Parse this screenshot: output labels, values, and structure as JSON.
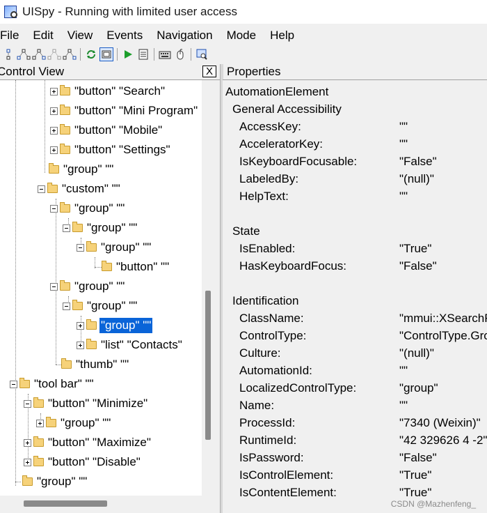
{
  "window": {
    "title": "UISpy - Running with limited user access"
  },
  "menu": [
    "File",
    "Edit",
    "View",
    "Events",
    "Navigation",
    "Mode",
    "Help"
  ],
  "toolbar": [
    "show-parent-icon",
    "show-first-child-icon",
    "show-next-sibling-icon",
    "show-prev-sibling-icon",
    "show-last-child-icon",
    "refresh-icon",
    "focus-tracking-icon",
    "run-icon",
    "properties-icon",
    "keyboard-icon",
    "mouse-icon",
    "screenshot-icon"
  ],
  "left_pane": {
    "title": "Control View",
    "close": "X"
  },
  "tree": [
    {
      "label": "\"button\" \"Search\""
    },
    {
      "label": "\"button\" \"Mini Program\""
    },
    {
      "label": "\"button\" \"Mobile\""
    },
    {
      "label": "\"button\" \"Settings\""
    },
    {
      "label": "\"group\" \"\""
    },
    {
      "label": "\"custom\" \"\""
    },
    {
      "label": "\"group\" \"\""
    },
    {
      "label": "\"group\" \"\""
    },
    {
      "label": "\"group\" \"\""
    },
    {
      "label": "\"button\" \"\""
    },
    {
      "label": "\"group\" \"\""
    },
    {
      "label": "\"group\" \"\""
    },
    {
      "label": "\"group\" \"\""
    },
    {
      "label": "\"list\" \"Contacts\""
    },
    {
      "label": "\"thumb\" \"\""
    },
    {
      "label": "\"tool bar\" \"\""
    },
    {
      "label": "\"button\" \"Minimize\""
    },
    {
      "label": "\"group\" \"\""
    },
    {
      "label": "\"button\" \"Maximize\""
    },
    {
      "label": "\"button\" \"Disable\""
    },
    {
      "label": "\"group\" \"\""
    }
  ],
  "right_pane": {
    "title": "Properties"
  },
  "properties": {
    "root": "AutomationElement",
    "sections": [
      {
        "title": "General Accessibility",
        "props": [
          {
            "name": "AccessKey:",
            "value": "\"\""
          },
          {
            "name": "AcceleratorKey:",
            "value": "\"\""
          },
          {
            "name": "IsKeyboardFocusable:",
            "value": "\"False\""
          },
          {
            "name": "LabeledBy:",
            "value": "\"(null)\""
          },
          {
            "name": "HelpText:",
            "value": "\"\""
          }
        ]
      },
      {
        "title": "State",
        "props": [
          {
            "name": "IsEnabled:",
            "value": "\"True\""
          },
          {
            "name": "HasKeyboardFocus:",
            "value": "\"False\""
          }
        ]
      },
      {
        "title": "Identification",
        "props": [
          {
            "name": "ClassName:",
            "value": "\"mmui::XSearchField\""
          },
          {
            "name": "ControlType:",
            "value": "\"ControlType.Group\""
          },
          {
            "name": "Culture:",
            "value": "\"(null)\""
          },
          {
            "name": "AutomationId:",
            "value": "\"\""
          },
          {
            "name": "LocalizedControlType:",
            "value": "\"group\""
          },
          {
            "name": "Name:",
            "value": "\"\""
          },
          {
            "name": "ProcessId:",
            "value": "\"7340 (Weixin)\""
          },
          {
            "name": "RuntimeId:",
            "value": "\"42 329626 4 -2\""
          },
          {
            "name": "IsPassword:",
            "value": "\"False\""
          },
          {
            "name": "IsControlElement:",
            "value": "\"True\""
          },
          {
            "name": "IsContentElement:",
            "value": "\"True\""
          }
        ]
      }
    ]
  },
  "watermark": "CSDN @Mazhenfeng_"
}
